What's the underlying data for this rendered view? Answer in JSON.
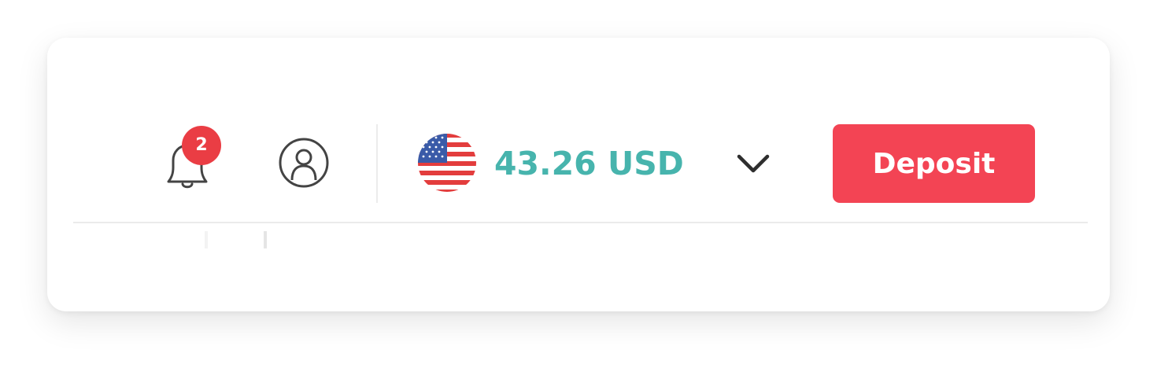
{
  "notifications": {
    "icon": "bell-icon",
    "count": "2",
    "badge_color": "#ea3d44"
  },
  "account": {
    "icon": "user-circle-icon"
  },
  "wallet": {
    "flag_icon": "us-flag-icon",
    "balance": "43.26 USD",
    "balance_color": "#47b4ad",
    "dropdown_icon": "chevron-down-icon"
  },
  "actions": {
    "deposit_label": "Deposit",
    "deposit_color": "#f34454"
  }
}
